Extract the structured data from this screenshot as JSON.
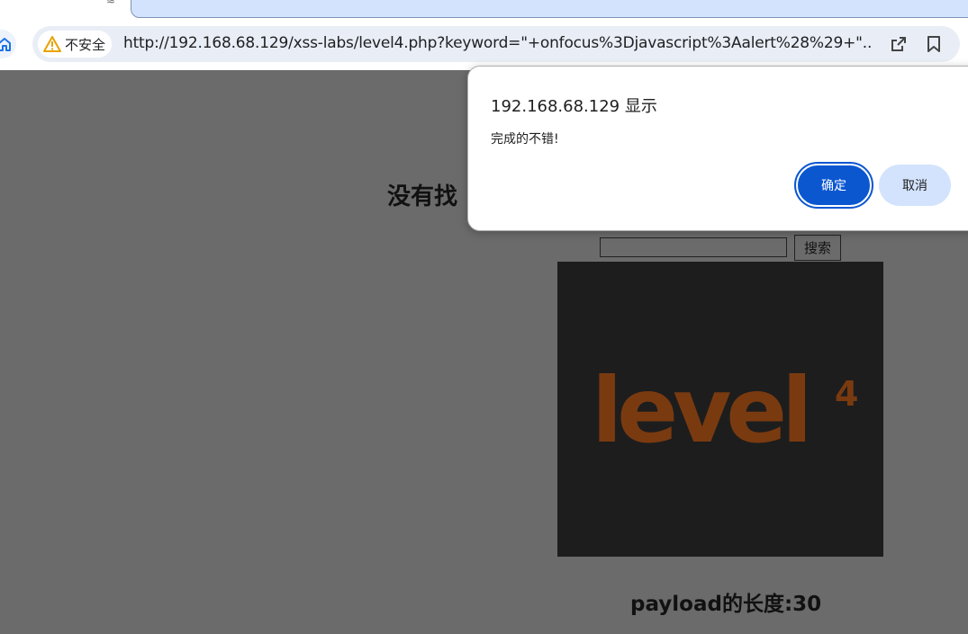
{
  "browser": {
    "security_label": "不安全",
    "url": "http://192.168.68.129/xss-labs/level4.php?keyword=\"+onfocus%3Djavascript%3Aalert%28%29+\"..."
  },
  "page": {
    "heading_visible": "没有找",
    "search_button_label": "搜索",
    "search_input_value": "",
    "level_image_text": "level",
    "level_image_superscript": "4",
    "payload_length_text": "payload的长度:30"
  },
  "dialog": {
    "title": "192.168.68.129 显示",
    "message": "完成的不错!",
    "ok_label": "确定",
    "cancel_label": "取消"
  },
  "colors": {
    "page_background": "#6b6b6b",
    "level_image_background": "#1d1d1d",
    "level_text": "#7a3a10",
    "ok_button": "#0b57d0",
    "cancel_button": "#d3e3fd",
    "address_bar": "#e9eef6",
    "warning_icon": "#f2b705"
  },
  "icons": {
    "home": "home-icon",
    "warning": "warning-icon",
    "share": "share-icon",
    "bookmark": "bookmark-icon"
  }
}
